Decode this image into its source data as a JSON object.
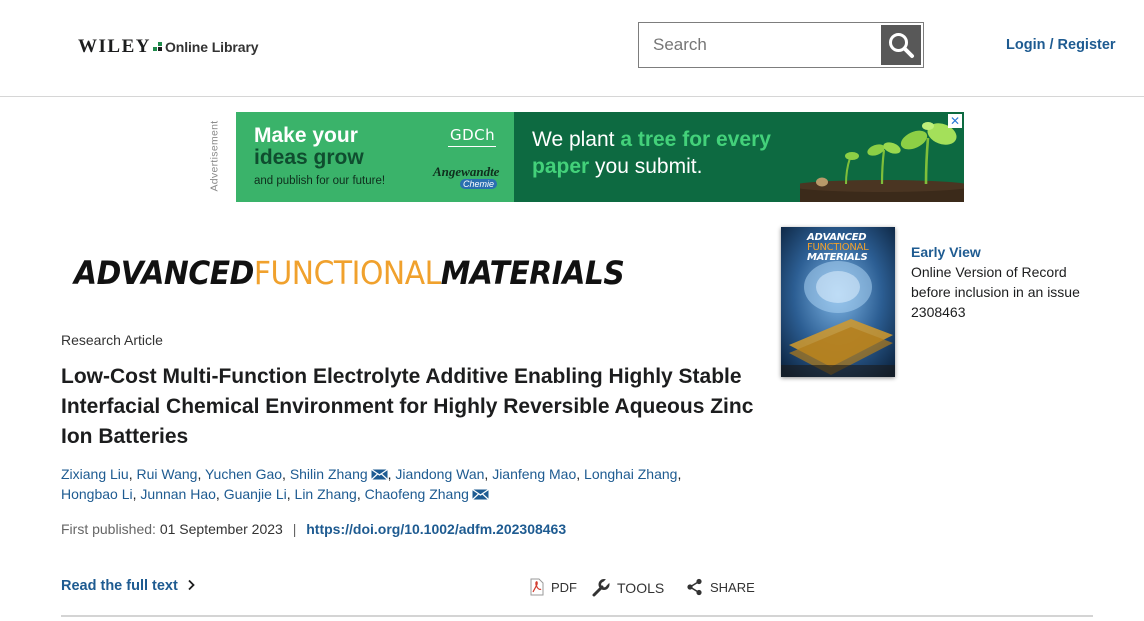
{
  "header": {
    "logo_wiley": "WILEY",
    "logo_library": "Online Library",
    "search_placeholder": "Search",
    "login_label": "Login / Register"
  },
  "ad": {
    "label": "Advertisement",
    "headline_line1": "Make your",
    "headline_line2": "ideas grow",
    "sub": "and publish for our future!",
    "gdch": "GDCh",
    "angewandte": "Angewandte",
    "chemie": "Chemie",
    "msg_part1": "We plant ",
    "msg_highlight1": "a tree for every",
    "msg_highlight2": "paper",
    "msg_part2": " you submit.",
    "close": "✕",
    "colors": {
      "left_bg": "#3ab36a",
      "right_bg": "#0d6a41",
      "highlight": "#43d17a"
    }
  },
  "journal": {
    "word1": "ADVANCED",
    "word2": "FUNCTIONAL",
    "word3": "MATERIALS",
    "cover_title1": "ADVANCED",
    "cover_title2": "FUNCTIONAL",
    "cover_title3": "MATERIALS",
    "colors": {
      "accent": "#f0a12d"
    }
  },
  "issue_info": {
    "title": "Early View",
    "line1": "Online Version of Record",
    "line2": "before inclusion in an issue",
    "article_number": "2308463"
  },
  "article": {
    "type": "Research Article",
    "title": "Low-Cost Multi-Function Electrolyte Additive Enabling Highly Stable Interfacial Chemical Environment for Highly Reversible Aqueous Zinc Ion Batteries",
    "authors": [
      "Zixiang Liu",
      "Rui Wang",
      "Yuchen Gao",
      "Shilin Zhang",
      "Jiandong Wan",
      "Jianfeng Mao",
      "Longhai Zhang",
      "Hongbao Li",
      "Junnan Hao",
      "Guanjie Li",
      "Lin Zhang",
      "Chaofeng Zhang"
    ],
    "first_published_label": "First published:",
    "first_published_date": "01 September 2023",
    "separator": "|",
    "doi": "https://doi.org/10.1002/adfm.202308463"
  },
  "actions": {
    "read_full": "Read the full text",
    "pdf": "PDF",
    "tools": "TOOLS",
    "share": "SHARE"
  },
  "colors": {
    "link": "#1e5b91",
    "search_button": "#585858"
  }
}
